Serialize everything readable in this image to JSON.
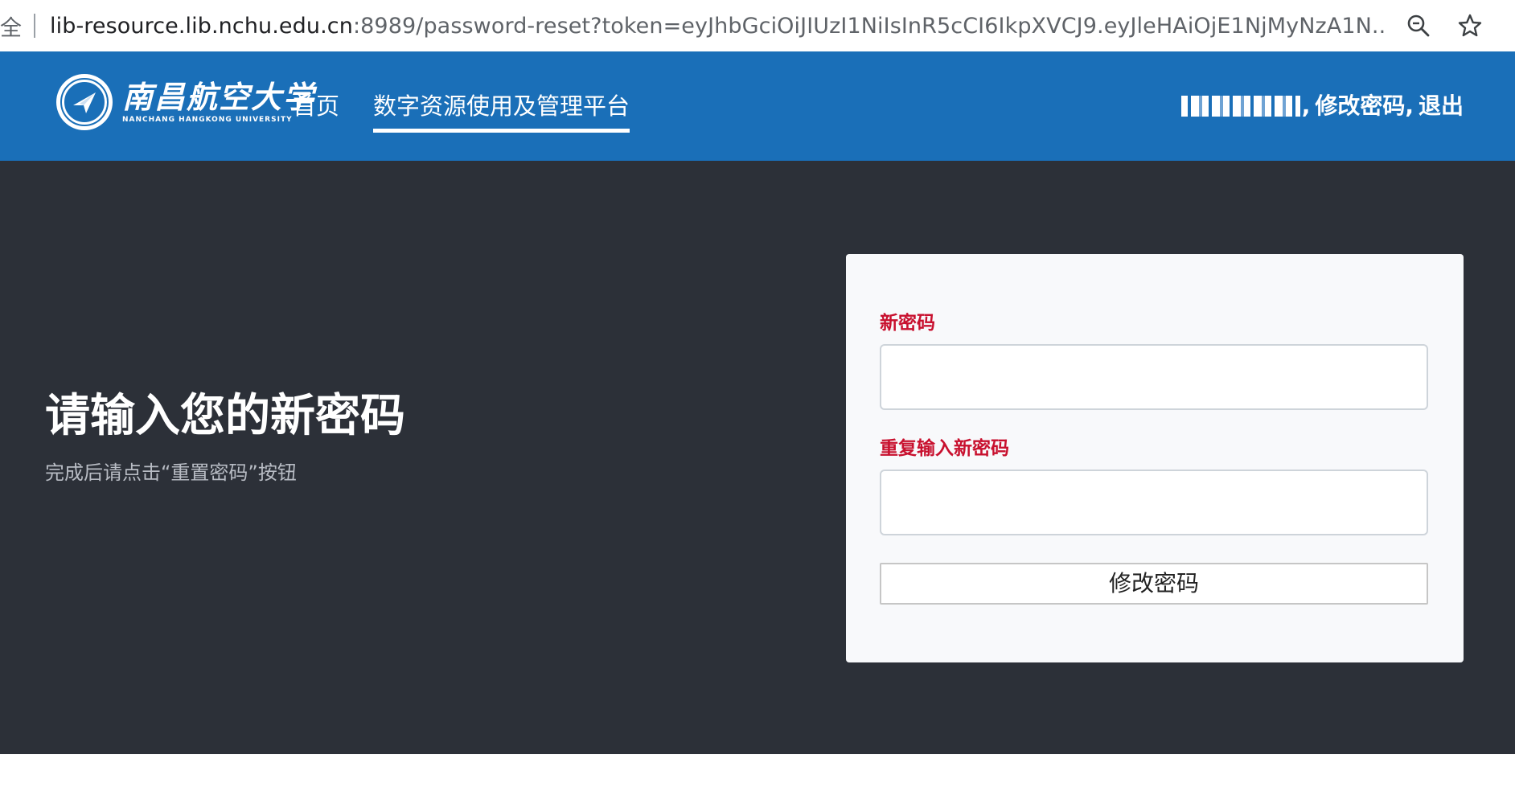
{
  "browser": {
    "lock_glyph": "全",
    "url_host": "lib-resource.lib.nchu.edu.cn",
    "url_rest": ":8989/password-reset?token=eyJhbGciOiJIUzI1NiIsInR5cCI6IkpXVCJ9.eyJleHAiOjE1NjMyNzA1N...",
    "zoom_icon": "magnifier-icon",
    "bookmark_icon": "star-icon"
  },
  "header": {
    "logo_cn": "南昌航空大学",
    "logo_en": "NANCHANG HANGKONG UNIVERSITY",
    "nav_home": "首页",
    "nav_platform": "数字资源使用及管理平台",
    "user_sep1": ",",
    "change_password": "修改密码",
    "user_sep2": ",",
    "logout": "退出",
    "bg_color": "#1a6fb8"
  },
  "hero": {
    "title": "请输入您的新密码",
    "subtitle": "完成后请点击“重置密码”按钮",
    "bg_color": "#2c3038"
  },
  "form": {
    "new_password_label": "新密码",
    "new_password_value": "",
    "repeat_password_label": "重复输入新密码",
    "repeat_password_value": "",
    "submit_label": "修改密码",
    "label_color": "#c8102e"
  }
}
